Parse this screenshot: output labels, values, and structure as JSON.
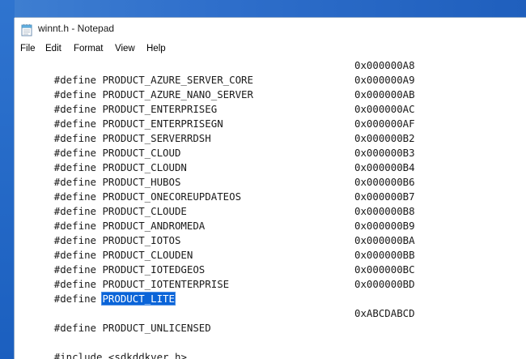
{
  "window": {
    "title": "winnt.h - Notepad",
    "icon": "notepad-icon"
  },
  "menubar": {
    "items": [
      "File",
      "Edit",
      "Format",
      "View",
      "Help"
    ]
  },
  "editor": {
    "lines": [
      {
        "directive": "#define",
        "name": "PRODUCT_AZURE_SERVER_CORE",
        "value": "0x000000A8"
      },
      {
        "directive": "#define",
        "name": "PRODUCT_AZURE_NANO_SERVER",
        "value": "0x000000A9"
      },
      {
        "directive": "#define",
        "name": "PRODUCT_ENTERPRISEG",
        "value": "0x000000AB"
      },
      {
        "directive": "#define",
        "name": "PRODUCT_ENTERPRISEGN",
        "value": "0x000000AC"
      },
      {
        "directive": "#define",
        "name": "PRODUCT_SERVERRDSH",
        "value": "0x000000AF"
      },
      {
        "directive": "#define",
        "name": "PRODUCT_CLOUD",
        "value": "0x000000B2"
      },
      {
        "directive": "#define",
        "name": "PRODUCT_CLOUDN",
        "value": "0x000000B3"
      },
      {
        "directive": "#define",
        "name": "PRODUCT_HUBOS",
        "value": "0x000000B4"
      },
      {
        "directive": "#define",
        "name": "PRODUCT_ONECOREUPDATEOS",
        "value": "0x000000B6"
      },
      {
        "directive": "#define",
        "name": "PRODUCT_CLOUDE",
        "value": "0x000000B7"
      },
      {
        "directive": "#define",
        "name": "PRODUCT_ANDROMEDA",
        "value": "0x000000B8"
      },
      {
        "directive": "#define",
        "name": "PRODUCT_IOTOS",
        "value": "0x000000B9"
      },
      {
        "directive": "#define",
        "name": "PRODUCT_CLOUDEN",
        "value": "0x000000BA"
      },
      {
        "directive": "#define",
        "name": "PRODUCT_IOTEDGEOS",
        "value": "0x000000BB"
      },
      {
        "directive": "#define",
        "name": "PRODUCT_IOTENTERPRISE",
        "value": "0x000000BC"
      },
      {
        "directive": "#define",
        "name": "PRODUCT_LITE",
        "value": "0x000000BD",
        "selected": true
      },
      {
        "directive": "#define",
        "name": "PRODUCT_UNLICENSED",
        "value": "0xABCDABCD"
      },
      {
        "directive": "#include",
        "name": "<sdkddkver.h>",
        "value": ""
      }
    ],
    "selection_color": "#0a64d8"
  }
}
